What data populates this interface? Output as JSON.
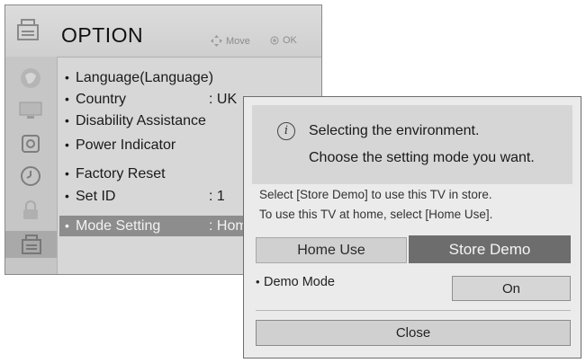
{
  "menu": {
    "title": "OPTION",
    "hint_move": "Move",
    "hint_ok": "OK",
    "side_icons": [
      "picture-icon",
      "monitor-icon",
      "speaker-icon",
      "clock-icon",
      "lock-icon",
      "option-icon"
    ],
    "items": [
      {
        "label": "Language(Language)",
        "value": ""
      },
      {
        "label": "Country",
        "value": ": UK"
      },
      {
        "label": "Disability Assistance",
        "value": ""
      },
      {
        "label": "Power Indicator",
        "value": ""
      },
      {
        "label": "Factory Reset",
        "value": ""
      },
      {
        "label": "Set ID",
        "value": ": 1"
      },
      {
        "label": "Mode Setting",
        "value": ": Home"
      }
    ]
  },
  "dialog": {
    "heading_line1": "Selecting the environment.",
    "heading_line2": "Choose the setting mode you want.",
    "desc_line1": "Select [Store Demo] to use this TV in store.",
    "desc_line2": "To use this TV at home, select [Home Use].",
    "home_use": "Home Use",
    "store_demo": "Store Demo",
    "demo_mode_label": "Demo Mode",
    "demo_mode_value": "On",
    "close": "Close"
  },
  "colors": {
    "selected_item_bg": "#8d8d8d",
    "store_demo_bg": "#6d6d6d"
  }
}
